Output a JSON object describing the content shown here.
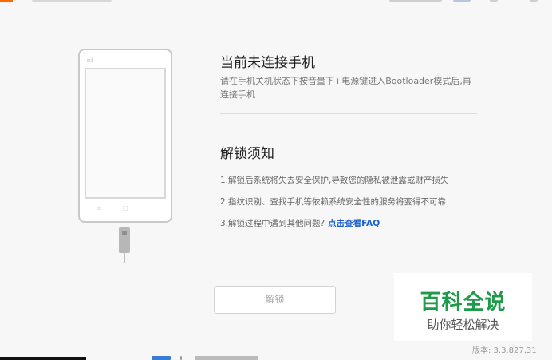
{
  "colors": {
    "brand": "#ff6700",
    "link": "#1a5fd0",
    "watermark_green": "#1f9a49",
    "background": "#f7f7f7"
  },
  "phone": {
    "brand_mark": "mi",
    "keys": [
      "≡",
      "□",
      "‹"
    ]
  },
  "connection": {
    "title": "当前未连接手机",
    "description": "请在手机关机状态下按音量下+电源键进入Bootloader模式后,再连接手机"
  },
  "notice": {
    "title": "解锁须知",
    "rules": [
      "1.解锁后系统将失去安全保护,导致您的隐私被泄露或财产损失",
      "2.指纹识别、查找手机等依赖系统安全性的服务将变得不可靠",
      "3.解锁过程中遇到其他问题?"
    ],
    "faq_link": "点击查看FAQ"
  },
  "unlock_button": "解锁",
  "watermark": {
    "title": "百科全说",
    "subtitle": "助你轻松解决"
  },
  "version": "版本: 3.3.827.31"
}
